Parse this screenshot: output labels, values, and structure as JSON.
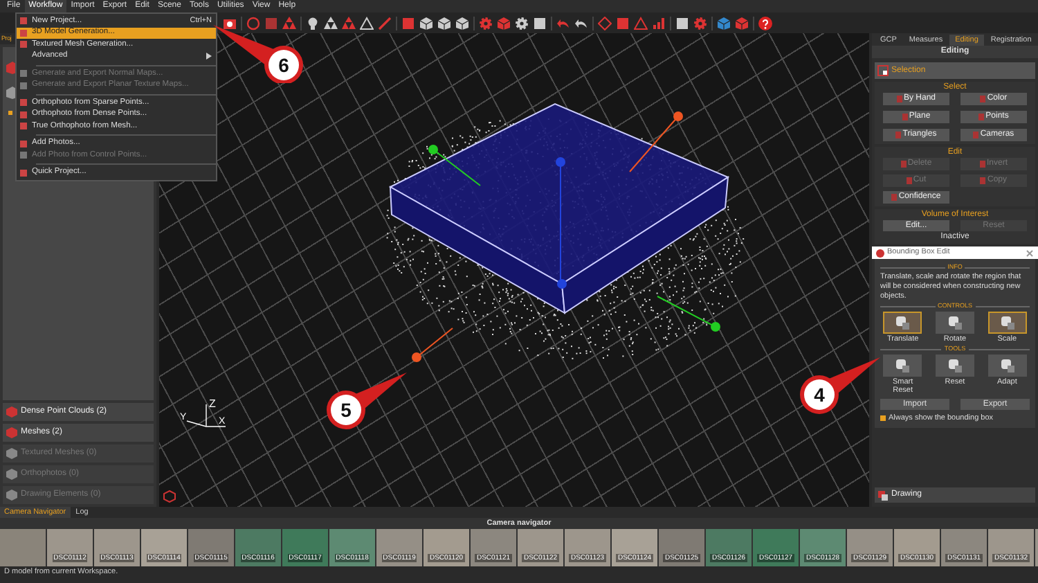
{
  "menu_bar": [
    {
      "label": "File",
      "selected": false
    },
    {
      "label": "Workflow",
      "selected": true
    },
    {
      "label": "Import",
      "selected": false
    },
    {
      "label": "Export",
      "selected": false
    },
    {
      "label": "Edit",
      "selected": false
    },
    {
      "label": "Scene",
      "selected": false
    },
    {
      "label": "Tools",
      "selected": false
    },
    {
      "label": "Utilities",
      "selected": false
    },
    {
      "label": "View",
      "selected": false
    },
    {
      "label": "Help",
      "selected": false
    }
  ],
  "workflow_menu": [
    {
      "kind": "item",
      "label": "New Project...",
      "shortcut": "Ctrl+N",
      "selected": false,
      "disabled": false
    },
    {
      "kind": "item",
      "label": "3D Model Generation...",
      "selected": true,
      "disabled": false
    },
    {
      "kind": "item",
      "label": "Textured Mesh Generation...",
      "selected": false,
      "disabled": false
    },
    {
      "kind": "submenu",
      "label": "Advanced",
      "selected": false,
      "disabled": false
    },
    {
      "kind": "separator"
    },
    {
      "kind": "item",
      "label": "Generate and Export Normal Maps...",
      "selected": false,
      "disabled": true
    },
    {
      "kind": "item",
      "label": "Generate and Export Planar Texture Maps...",
      "selected": false,
      "disabled": true
    },
    {
      "kind": "separator"
    },
    {
      "kind": "item",
      "label": "Orthophoto from Sparse Points...",
      "selected": false,
      "disabled": false
    },
    {
      "kind": "item",
      "label": "Orthophoto from Dense Points...",
      "selected": false,
      "disabled": false
    },
    {
      "kind": "item",
      "label": "True Orthophoto from Mesh...",
      "selected": false,
      "disabled": false
    },
    {
      "kind": "separator"
    },
    {
      "kind": "item",
      "label": "Add Photos...",
      "selected": false,
      "disabled": false
    },
    {
      "kind": "item",
      "label": "Add Photo from Control Points...",
      "selected": false,
      "disabled": true
    },
    {
      "kind": "separator"
    },
    {
      "kind": "item",
      "label": "Quick Project...",
      "selected": false,
      "disabled": false
    }
  ],
  "left_panel": {
    "tab": "Proj",
    "items": [
      {
        "label": "Dense Point Clouds (2)",
        "disabled": false
      },
      {
        "label": "Meshes (2)",
        "disabled": false
      },
      {
        "label": "Textured Meshes (0)",
        "disabled": true
      },
      {
        "label": "Orthophotos (0)",
        "disabled": true
      },
      {
        "label": "Drawing Elements (0)",
        "disabled": true
      }
    ]
  },
  "viewport": {
    "axis_labels": {
      "x": "X",
      "y": "Y",
      "z": "Z"
    }
  },
  "callouts": [
    {
      "number": "6"
    },
    {
      "number": "5"
    },
    {
      "number": "4"
    }
  ],
  "right_panel": {
    "tabs": [
      {
        "label": "GCP",
        "selected": false
      },
      {
        "label": "Measures",
        "selected": false
      },
      {
        "label": "Editing",
        "selected": true
      },
      {
        "label": "Registration",
        "selected": false
      }
    ],
    "title": "Editing",
    "mode": "Selection",
    "select": {
      "heading": "Select",
      "buttons": [
        {
          "label": "By Hand"
        },
        {
          "label": "Color"
        },
        {
          "label": "Plane"
        },
        {
          "label": "Points"
        },
        {
          "label": "Triangles"
        },
        {
          "label": "Cameras"
        }
      ]
    },
    "edit": {
      "heading": "Edit",
      "buttons": [
        {
          "label": "Delete",
          "disabled": true
        },
        {
          "label": "Invert",
          "disabled": true
        },
        {
          "label": "Cut",
          "disabled": true
        },
        {
          "label": "Copy",
          "disabled": true
        },
        {
          "label": "Confidence",
          "disabled": false
        }
      ]
    },
    "volume_of_interest": {
      "heading": "Volume of Interest",
      "buttons": [
        {
          "label": "Edit...",
          "disabled": false
        },
        {
          "label": "Reset",
          "disabled": true
        }
      ],
      "status": "Inactive"
    },
    "bounding_box_edit": {
      "title": "Bounding Box Edit",
      "info_heading": "INFO",
      "info": "Translate, scale and rotate the region that will be considered when constructing new objects.",
      "controls_heading": "CONTROLS",
      "controls": [
        {
          "label": "Translate",
          "selected": true
        },
        {
          "label": "Rotate",
          "selected": false
        },
        {
          "label": "Scale",
          "selected": true
        }
      ],
      "tools_heading": "TOOLS",
      "tools": [
        {
          "label": "Smart Reset"
        },
        {
          "label": "Reset"
        },
        {
          "label": "Adapt"
        }
      ],
      "buttons": [
        "Import",
        "Export"
      ],
      "always_show": {
        "label": "Always show the bounding box",
        "checked": true
      }
    },
    "drawing": "Drawing"
  },
  "camera_navigator": {
    "tabs": [
      {
        "label": "Camera Navigator",
        "selected": true
      },
      {
        "label": "Log",
        "selected": false
      }
    ],
    "title": "Camera navigator",
    "thumbnails": [
      {
        "label": "DSC01112"
      },
      {
        "label": "DSC01113"
      },
      {
        "label": "DSC01114"
      },
      {
        "label": "DSC01115"
      },
      {
        "label": "DSC01116"
      },
      {
        "label": "DSC01117"
      },
      {
        "label": "DSC01118"
      },
      {
        "label": "DSC01119"
      },
      {
        "label": "DSC01120"
      },
      {
        "label": "DSC01121"
      },
      {
        "label": "DSC01122"
      },
      {
        "label": "DSC01123"
      },
      {
        "label": "DSC01124"
      },
      {
        "label": "DSC01125"
      },
      {
        "label": "DSC01126"
      },
      {
        "label": "DSC01127"
      },
      {
        "label": "DSC01128"
      },
      {
        "label": "DSC01129"
      },
      {
        "label": "DSC01130"
      },
      {
        "label": "DSC01131"
      },
      {
        "label": "DSC01132"
      }
    ]
  },
  "status_bar": "D model from current Workspace."
}
